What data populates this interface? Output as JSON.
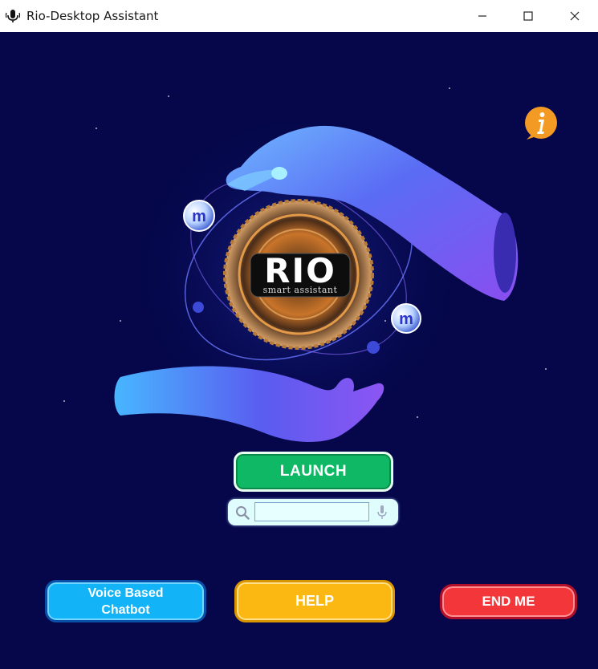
{
  "window": {
    "title": "Rio-Desktop Assistant",
    "icon": "microphone-icon",
    "controls": [
      "minimize-icon",
      "maximize-icon",
      "close-icon"
    ]
  },
  "logo": {
    "title": "RIO",
    "subtitle": "smart assistant"
  },
  "info_button": {
    "icon": "info-icon"
  },
  "launch": {
    "label": "LAUNCH"
  },
  "search": {
    "icon": "search-icon",
    "value": "",
    "mic_icon": "microphone-icon"
  },
  "buttons": {
    "chatbot_line1": "Voice Based",
    "chatbot_line2": "Chatbot",
    "help": "HELP",
    "end": "END ME"
  },
  "colors": {
    "background": "#05074a",
    "launch": "#0fb864",
    "chatbot": "#13b4f7",
    "help": "#fbb813",
    "end": "#f2363a",
    "info": "#f39a24"
  }
}
